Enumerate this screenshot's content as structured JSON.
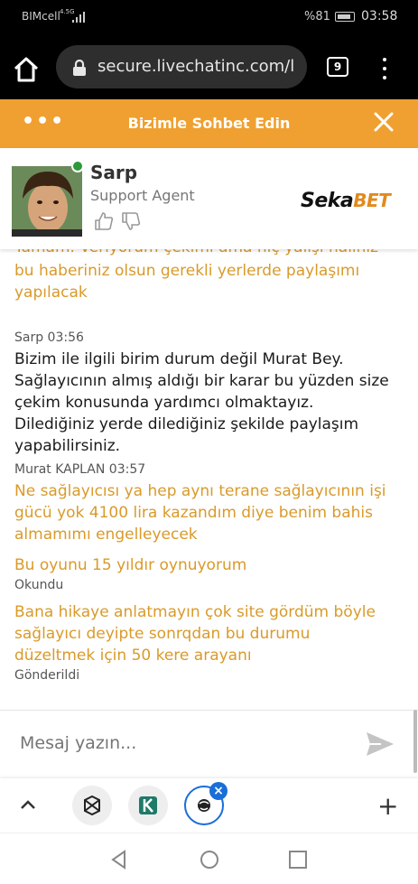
{
  "status_bar": {
    "carrier": "BIMcell",
    "network": "4.5G",
    "battery": "%81",
    "time": "03:58"
  },
  "browser": {
    "url": "secure.livechatinc.com/l",
    "tab_count": "9"
  },
  "chat_header": {
    "title": "Bizimle Sohbet Edin",
    "menu_dots": "•••"
  },
  "agent": {
    "name": "Sarp",
    "role": "Support Agent",
    "online": true
  },
  "logo": {
    "part1": "Seka",
    "part2": "BET"
  },
  "messages": {
    "clipped_top": "Tamam. Veriyorum çekimi ama hiç yalışı haliniz",
    "prev_tail": "bu haberiniz olsun gerekli yerlerde paylaşımı yapılacak",
    "agent_meta": "Sarp 03:56",
    "agent_text": "Bizim ile ilgili birim durum değil Murat Bey. Sağlayıcının almış aldığı bir karar bu yüzden size çekim konusunda yardımcı olmaktayız. Dilediğiniz yerde dilediğiniz şekilde paylaşım yapabilirsiniz.",
    "user_meta": "Murat KAPLAN 03:57",
    "user_text1": "Ne sağlayıcısı ya hep aynı terane sağlayıcının işi gücü yok 4100 lira kazandım diye benim bahis almamımı engelleyecek",
    "user_text2": "Bu oyunu 15 yıldır oynuyorum",
    "status_read": "Okundu",
    "user_text3": "Bana hikaye anlatmayın çok site gördüm böyle sağlayıcı deyipte sonrqdan bu durumu düzeltmek için 50 kere arayanı",
    "status_sent": "Gönderildi"
  },
  "input": {
    "placeholder": "Mesaj yazın..."
  },
  "colors": {
    "accent": "#f0a030",
    "user_text": "#d99a2a",
    "tab_active": "#1a6ed8"
  }
}
